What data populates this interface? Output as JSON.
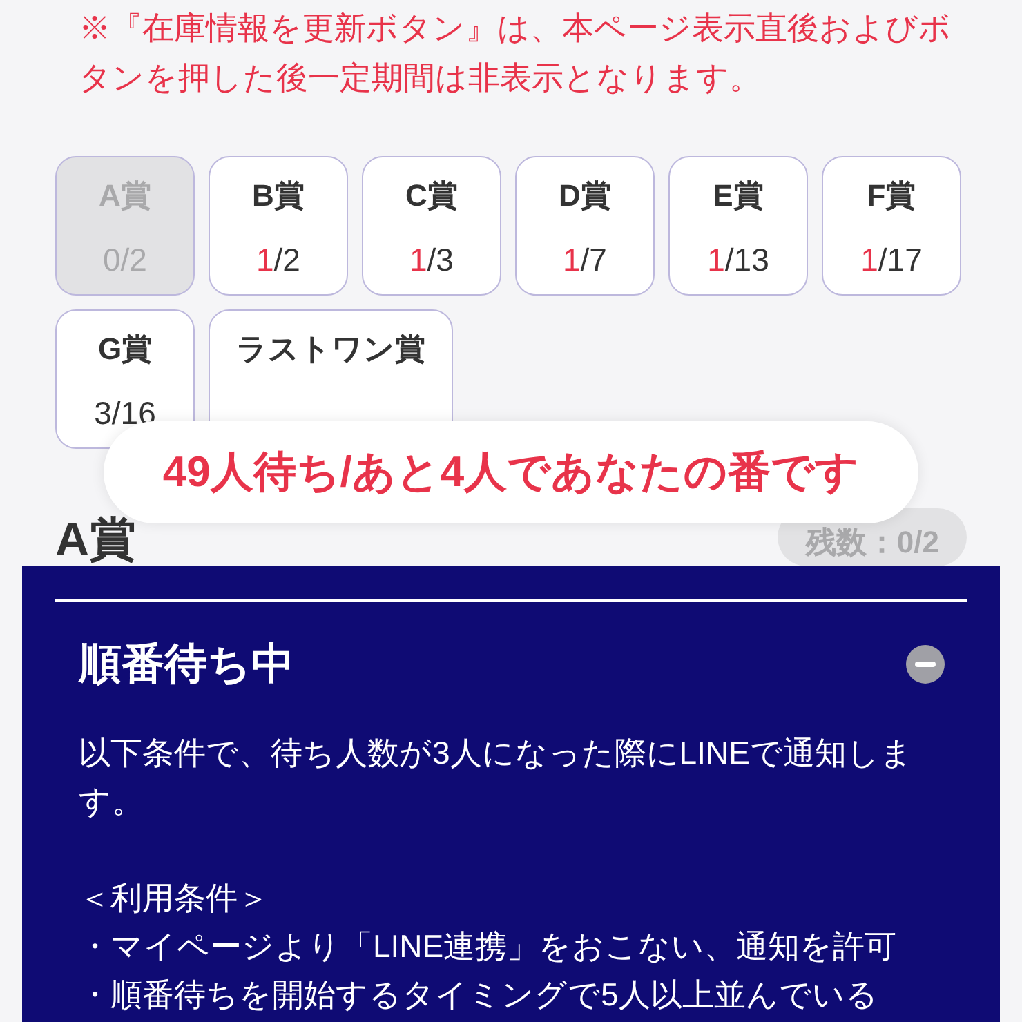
{
  "notice": "※『在庫情報を更新ボタン』は、本ページ表示直後およびボタンを押した後一定期間は非表示となります。",
  "prizes": [
    {
      "name": "A賞",
      "disabled": true,
      "count": {
        "remaining": "0",
        "of_total": "/2",
        "highlight": false
      }
    },
    {
      "name": "B賞",
      "disabled": false,
      "count": {
        "remaining": "1",
        "of_total": "/2",
        "highlight": true
      }
    },
    {
      "name": "C賞",
      "disabled": false,
      "count": {
        "remaining": "1",
        "of_total": "/3",
        "highlight": true
      }
    },
    {
      "name": "D賞",
      "disabled": false,
      "count": {
        "remaining": "1",
        "of_total": "/7",
        "highlight": true
      }
    },
    {
      "name": "E賞",
      "disabled": false,
      "count": {
        "remaining": "1",
        "of_total": "/13",
        "highlight": true
      }
    },
    {
      "name": "F賞",
      "disabled": false,
      "count": {
        "remaining": "1",
        "of_total": "/17",
        "highlight": true
      }
    },
    {
      "name": "G賞",
      "disabled": false,
      "count": {
        "remaining": "3",
        "of_total": "/16",
        "highlight": false
      }
    },
    {
      "name": "ラストワン賞",
      "disabled": false
    }
  ],
  "queue_toast": "49人待ち/あと4人であなたの番です",
  "section": {
    "title": "A賞",
    "stock_badge": "残数：0/2"
  },
  "panel": {
    "title": "順番待ち中",
    "expanded": true,
    "description": "以下条件で、待ち人数が3人になった際にLINEで通知します。",
    "conditions_heading": "＜利用条件＞",
    "conditions": [
      "・マイページより「LINE連携」をおこない、通知を許可",
      "・順番待ちを開始するタイミングで5人以上並んでいる"
    ]
  }
}
